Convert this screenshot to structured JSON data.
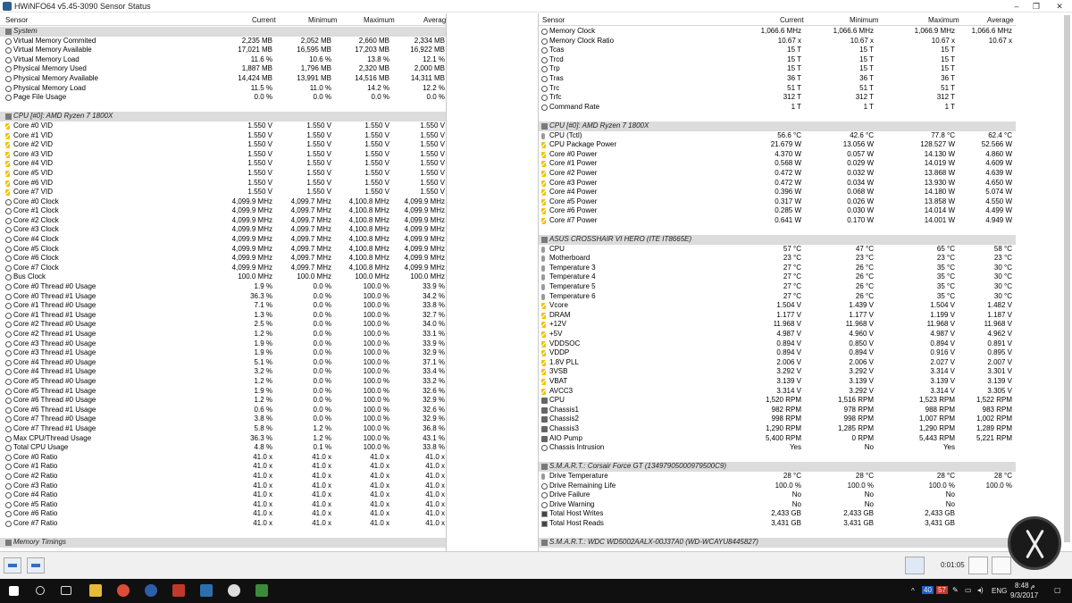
{
  "window": {
    "title": "HWiNFO64 v5.45-3090 Sensor Status"
  },
  "columns": {
    "sensor": "Sensor",
    "current": "Current",
    "minimum": "Minimum",
    "maximum": "Maximum",
    "average": "Average"
  },
  "left_rows": [
    {
      "g": 1,
      "name": "System"
    },
    {
      "i": "gauge",
      "name": "Virtual Memory Commited",
      "cur": "2,235 MB",
      "min": "2,052 MB",
      "max": "2,660 MB",
      "avg": "2,334 MB"
    },
    {
      "i": "gauge",
      "name": "Virtual Memory Available",
      "cur": "17,021 MB",
      "min": "16,595 MB",
      "max": "17,203 MB",
      "avg": "16,922 MB"
    },
    {
      "i": "gauge",
      "name": "Virtual Memory Load",
      "cur": "11.6 %",
      "min": "10.6 %",
      "max": "13.8 %",
      "avg": "12.1 %"
    },
    {
      "i": "gauge",
      "name": "Physical Memory Used",
      "cur": "1,887 MB",
      "min": "1,796 MB",
      "max": "2,320 MB",
      "avg": "2,000 MB"
    },
    {
      "i": "gauge",
      "name": "Physical Memory Available",
      "cur": "14,424 MB",
      "min": "13,991 MB",
      "max": "14,516 MB",
      "avg": "14,311 MB"
    },
    {
      "i": "gauge",
      "name": "Physical Memory Load",
      "cur": "11.5 %",
      "min": "11.0 %",
      "max": "14.2 %",
      "avg": "12.2 %"
    },
    {
      "i": "gauge",
      "name": "Page File Usage",
      "cur": "0.0 %",
      "min": "0.0 %",
      "max": "0.0 %",
      "avg": "0.0 %"
    },
    {
      "blank": 1
    },
    {
      "g": 1,
      "name": "CPU [#0]: AMD Ryzen 7 1800X"
    },
    {
      "i": "bolt",
      "name": "Core #0 VID",
      "cur": "1.550 V",
      "min": "1.550 V",
      "max": "1.550 V",
      "avg": "1.550 V"
    },
    {
      "i": "bolt",
      "name": "Core #1 VID",
      "cur": "1.550 V",
      "min": "1.550 V",
      "max": "1.550 V",
      "avg": "1.550 V"
    },
    {
      "i": "bolt",
      "name": "Core #2 VID",
      "cur": "1.550 V",
      "min": "1.550 V",
      "max": "1.550 V",
      "avg": "1.550 V"
    },
    {
      "i": "bolt",
      "name": "Core #3 VID",
      "cur": "1.550 V",
      "min": "1.550 V",
      "max": "1.550 V",
      "avg": "1.550 V"
    },
    {
      "i": "bolt",
      "name": "Core #4 VID",
      "cur": "1.550 V",
      "min": "1.550 V",
      "max": "1.550 V",
      "avg": "1.550 V"
    },
    {
      "i": "bolt",
      "name": "Core #5 VID",
      "cur": "1.550 V",
      "min": "1.550 V",
      "max": "1.550 V",
      "avg": "1.550 V"
    },
    {
      "i": "bolt",
      "name": "Core #6 VID",
      "cur": "1.550 V",
      "min": "1.550 V",
      "max": "1.550 V",
      "avg": "1.550 V"
    },
    {
      "i": "bolt",
      "name": "Core #7 VID",
      "cur": "1.550 V",
      "min": "1.550 V",
      "max": "1.550 V",
      "avg": "1.550 V"
    },
    {
      "i": "clock",
      "name": "Core #0 Clock",
      "cur": "4,099.9 MHz",
      "min": "4,099.7 MHz",
      "max": "4,100.8 MHz",
      "avg": "4,099.9 MHz"
    },
    {
      "i": "clock",
      "name": "Core #1 Clock",
      "cur": "4,099.9 MHz",
      "min": "4,099.7 MHz",
      "max": "4,100.8 MHz",
      "avg": "4,099.9 MHz"
    },
    {
      "i": "clock",
      "name": "Core #2 Clock",
      "cur": "4,099.9 MHz",
      "min": "4,099.7 MHz",
      "max": "4,100.8 MHz",
      "avg": "4,099.9 MHz"
    },
    {
      "i": "clock",
      "name": "Core #3 Clock",
      "cur": "4,099.9 MHz",
      "min": "4,099.7 MHz",
      "max": "4,100.8 MHz",
      "avg": "4,099.9 MHz"
    },
    {
      "i": "clock",
      "name": "Core #4 Clock",
      "cur": "4,099.9 MHz",
      "min": "4,099.7 MHz",
      "max": "4,100.8 MHz",
      "avg": "4,099.9 MHz"
    },
    {
      "i": "clock",
      "name": "Core #5 Clock",
      "cur": "4,099.9 MHz",
      "min": "4,099.7 MHz",
      "max": "4,100.8 MHz",
      "avg": "4,099.9 MHz"
    },
    {
      "i": "clock",
      "name": "Core #6 Clock",
      "cur": "4,099.9 MHz",
      "min": "4,099.7 MHz",
      "max": "4,100.8 MHz",
      "avg": "4,099.9 MHz"
    },
    {
      "i": "clock",
      "name": "Core #7 Clock",
      "cur": "4,099.9 MHz",
      "min": "4,099.7 MHz",
      "max": "4,100.8 MHz",
      "avg": "4,099.9 MHz"
    },
    {
      "i": "clock",
      "name": "Bus Clock",
      "cur": "100.0 MHz",
      "min": "100.0 MHz",
      "max": "100.0 MHz",
      "avg": "100.0 MHz"
    },
    {
      "i": "gauge",
      "name": "Core #0 Thread #0 Usage",
      "cur": "1.9 %",
      "min": "0.0 %",
      "max": "100.0 %",
      "avg": "33.9 %"
    },
    {
      "i": "gauge",
      "name": "Core #0 Thread #1 Usage",
      "cur": "36.3 %",
      "min": "0.0 %",
      "max": "100.0 %",
      "avg": "34.2 %"
    },
    {
      "i": "gauge",
      "name": "Core #1 Thread #0 Usage",
      "cur": "7.1 %",
      "min": "0.0 %",
      "max": "100.0 %",
      "avg": "33.8 %"
    },
    {
      "i": "gauge",
      "name": "Core #1 Thread #1 Usage",
      "cur": "1.3 %",
      "min": "0.0 %",
      "max": "100.0 %",
      "avg": "32.7 %"
    },
    {
      "i": "gauge",
      "name": "Core #2 Thread #0 Usage",
      "cur": "2.5 %",
      "min": "0.0 %",
      "max": "100.0 %",
      "avg": "34.0 %"
    },
    {
      "i": "gauge",
      "name": "Core #2 Thread #1 Usage",
      "cur": "1.2 %",
      "min": "0.0 %",
      "max": "100.0 %",
      "avg": "33.1 %"
    },
    {
      "i": "gauge",
      "name": "Core #3 Thread #0 Usage",
      "cur": "1.9 %",
      "min": "0.0 %",
      "max": "100.0 %",
      "avg": "33.9 %"
    },
    {
      "i": "gauge",
      "name": "Core #3 Thread #1 Usage",
      "cur": "1.9 %",
      "min": "0.0 %",
      "max": "100.0 %",
      "avg": "32.9 %"
    },
    {
      "i": "gauge",
      "name": "Core #4 Thread #0 Usage",
      "cur": "5.1 %",
      "min": "0.0 %",
      "max": "100.0 %",
      "avg": "37.1 %"
    },
    {
      "i": "gauge",
      "name": "Core #4 Thread #1 Usage",
      "cur": "3.2 %",
      "min": "0.0 %",
      "max": "100.0 %",
      "avg": "33.4 %"
    },
    {
      "i": "gauge",
      "name": "Core #5 Thread #0 Usage",
      "cur": "1.2 %",
      "min": "0.0 %",
      "max": "100.0 %",
      "avg": "33.2 %"
    },
    {
      "i": "gauge",
      "name": "Core #5 Thread #1 Usage",
      "cur": "1.9 %",
      "min": "0.0 %",
      "max": "100.0 %",
      "avg": "32.6 %"
    },
    {
      "i": "gauge",
      "name": "Core #6 Thread #0 Usage",
      "cur": "1.2 %",
      "min": "0.0 %",
      "max": "100.0 %",
      "avg": "32.9 %"
    },
    {
      "i": "gauge",
      "name": "Core #6 Thread #1 Usage",
      "cur": "0.6 %",
      "min": "0.0 %",
      "max": "100.0 %",
      "avg": "32.6 %"
    },
    {
      "i": "gauge",
      "name": "Core #7 Thread #0 Usage",
      "cur": "3.8 %",
      "min": "0.0 %",
      "max": "100.0 %",
      "avg": "32.9 %"
    },
    {
      "i": "gauge",
      "name": "Core #7 Thread #1 Usage",
      "cur": "5.8 %",
      "min": "1.2 %",
      "max": "100.0 %",
      "avg": "36.8 %"
    },
    {
      "i": "gauge",
      "name": "Max CPU/Thread Usage",
      "cur": "36.3 %",
      "min": "1.2 %",
      "max": "100.0 %",
      "avg": "43.1 %"
    },
    {
      "i": "gauge",
      "name": "Total CPU Usage",
      "cur": "4.8 %",
      "min": "0.1 %",
      "max": "100.0 %",
      "avg": "33.8 %"
    },
    {
      "i": "gauge",
      "name": "Core #0 Ratio",
      "cur": "41.0 x",
      "min": "41.0 x",
      "max": "41.0 x",
      "avg": "41.0 x"
    },
    {
      "i": "gauge",
      "name": "Core #1 Ratio",
      "cur": "41.0 x",
      "min": "41.0 x",
      "max": "41.0 x",
      "avg": "41.0 x"
    },
    {
      "i": "gauge",
      "name": "Core #2 Ratio",
      "cur": "41.0 x",
      "min": "41.0 x",
      "max": "41.0 x",
      "avg": "41.0 x"
    },
    {
      "i": "gauge",
      "name": "Core #3 Ratio",
      "cur": "41.0 x",
      "min": "41.0 x",
      "max": "41.0 x",
      "avg": "41.0 x"
    },
    {
      "i": "gauge",
      "name": "Core #4 Ratio",
      "cur": "41.0 x",
      "min": "41.0 x",
      "max": "41.0 x",
      "avg": "41.0 x"
    },
    {
      "i": "gauge",
      "name": "Core #5 Ratio",
      "cur": "41.0 x",
      "min": "41.0 x",
      "max": "41.0 x",
      "avg": "41.0 x"
    },
    {
      "i": "gauge",
      "name": "Core #6 Ratio",
      "cur": "41.0 x",
      "min": "41.0 x",
      "max": "41.0 x",
      "avg": "41.0 x"
    },
    {
      "i": "gauge",
      "name": "Core #7 Ratio",
      "cur": "41.0 x",
      "min": "41.0 x",
      "max": "41.0 x",
      "avg": "41.0 x"
    },
    {
      "blank": 1
    },
    {
      "g": 1,
      "name": "Memory Timings"
    }
  ],
  "right_rows": [
    {
      "i": "gauge",
      "name": "Memory Clock",
      "cur": "1,066.6 MHz",
      "min": "1,066.6 MHz",
      "max": "1,066.9 MHz",
      "avg": "1,066.6 MHz"
    },
    {
      "i": "gauge",
      "name": "Memory Clock Ratio",
      "cur": "10.67 x",
      "min": "10.67 x",
      "max": "10.67 x",
      "avg": "10.67 x"
    },
    {
      "i": "gauge",
      "name": "Tcas",
      "cur": "15 T",
      "min": "15 T",
      "max": "15 T",
      "avg": ""
    },
    {
      "i": "gauge",
      "name": "Trcd",
      "cur": "15 T",
      "min": "15 T",
      "max": "15 T",
      "avg": ""
    },
    {
      "i": "gauge",
      "name": "Trp",
      "cur": "15 T",
      "min": "15 T",
      "max": "15 T",
      "avg": ""
    },
    {
      "i": "gauge",
      "name": "Tras",
      "cur": "36 T",
      "min": "36 T",
      "max": "36 T",
      "avg": ""
    },
    {
      "i": "gauge",
      "name": "Trc",
      "cur": "51 T",
      "min": "51 T",
      "max": "51 T",
      "avg": ""
    },
    {
      "i": "gauge",
      "name": "Trfc",
      "cur": "312 T",
      "min": "312 T",
      "max": "312 T",
      "avg": ""
    },
    {
      "i": "gauge",
      "name": "Command Rate",
      "cur": "1 T",
      "min": "1 T",
      "max": "1 T",
      "avg": ""
    },
    {
      "blank": 1
    },
    {
      "g": 1,
      "name": "CPU [#0]: AMD Ryzen 7 1800X"
    },
    {
      "i": "therm",
      "name": "CPU (Tctl)",
      "cur": "56.6 °C",
      "min": "42.6 °C",
      "max": "77.8 °C",
      "avg": "62.4 °C"
    },
    {
      "i": "bolt",
      "name": "CPU Package Power",
      "cur": "21.679 W",
      "min": "13.056 W",
      "max": "128.527 W",
      "avg": "52.566 W"
    },
    {
      "i": "bolt",
      "name": "Core #0 Power",
      "cur": "4.370 W",
      "min": "0.057 W",
      "max": "14.130 W",
      "avg": "4.860 W"
    },
    {
      "i": "bolt",
      "name": "Core #1 Power",
      "cur": "0.568 W",
      "min": "0.029 W",
      "max": "14.019 W",
      "avg": "4.609 W"
    },
    {
      "i": "bolt",
      "name": "Core #2 Power",
      "cur": "0.472 W",
      "min": "0.032 W",
      "max": "13.868 W",
      "avg": "4.639 W"
    },
    {
      "i": "bolt",
      "name": "Core #3 Power",
      "cur": "0.472 W",
      "min": "0.034 W",
      "max": "13.930 W",
      "avg": "4.650 W"
    },
    {
      "i": "bolt",
      "name": "Core #4 Power",
      "cur": "0.396 W",
      "min": "0.068 W",
      "max": "14.180 W",
      "avg": "5.074 W"
    },
    {
      "i": "bolt",
      "name": "Core #5 Power",
      "cur": "0.317 W",
      "min": "0.026 W",
      "max": "13.858 W",
      "avg": "4.550 W"
    },
    {
      "i": "bolt",
      "name": "Core #6 Power",
      "cur": "0.285 W",
      "min": "0.030 W",
      "max": "14.014 W",
      "avg": "4.499 W"
    },
    {
      "i": "bolt",
      "name": "Core #7 Power",
      "cur": "0.641 W",
      "min": "0.170 W",
      "max": "14.001 W",
      "avg": "4.949 W"
    },
    {
      "blank": 1
    },
    {
      "g": 1,
      "name": "ASUS CROSSHAIR VI HERO (ITE IT8665E)"
    },
    {
      "i": "therm",
      "name": "CPU",
      "cur": "57 °C",
      "min": "47 °C",
      "max": "65 °C",
      "avg": "58 °C"
    },
    {
      "i": "therm",
      "name": "Motherboard",
      "cur": "23 °C",
      "min": "23 °C",
      "max": "23 °C",
      "avg": "23 °C"
    },
    {
      "i": "therm",
      "name": "Temperature 3",
      "cur": "27 °C",
      "min": "26 °C",
      "max": "35 °C",
      "avg": "30 °C"
    },
    {
      "i": "therm",
      "name": "Temperature 4",
      "cur": "27 °C",
      "min": "26 °C",
      "max": "35 °C",
      "avg": "30 °C"
    },
    {
      "i": "therm",
      "name": "Temperature 5",
      "cur": "27 °C",
      "min": "26 °C",
      "max": "35 °C",
      "avg": "30 °C"
    },
    {
      "i": "therm",
      "name": "Temperature 6",
      "cur": "27 °C",
      "min": "26 °C",
      "max": "35 °C",
      "avg": "30 °C"
    },
    {
      "i": "bolt",
      "name": "Vcore",
      "cur": "1.504 V",
      "min": "1.439 V",
      "max": "1.504 V",
      "avg": "1.482 V"
    },
    {
      "i": "bolt",
      "name": "DRAM",
      "cur": "1.177 V",
      "min": "1.177 V",
      "max": "1.199 V",
      "avg": "1.187 V"
    },
    {
      "i": "bolt",
      "name": "+12V",
      "cur": "11.968 V",
      "min": "11.968 V",
      "max": "11.968 V",
      "avg": "11.968 V"
    },
    {
      "i": "bolt",
      "name": "+5V",
      "cur": "4.987 V",
      "min": "4.960 V",
      "max": "4.987 V",
      "avg": "4.962 V"
    },
    {
      "i": "bolt",
      "name": "VDDSOC",
      "cur": "0.894 V",
      "min": "0.850 V",
      "max": "0.894 V",
      "avg": "0.891 V"
    },
    {
      "i": "bolt",
      "name": "VDDP",
      "cur": "0.894 V",
      "min": "0.894 V",
      "max": "0.916 V",
      "avg": "0.895 V"
    },
    {
      "i": "bolt",
      "name": "1.8V PLL",
      "cur": "2.006 V",
      "min": "2.006 V",
      "max": "2.027 V",
      "avg": "2.007 V"
    },
    {
      "i": "bolt",
      "name": "3VSB",
      "cur": "3.292 V",
      "min": "3.292 V",
      "max": "3.314 V",
      "avg": "3.301 V"
    },
    {
      "i": "bolt",
      "name": "VBAT",
      "cur": "3.139 V",
      "min": "3.139 V",
      "max": "3.139 V",
      "avg": "3.139 V"
    },
    {
      "i": "bolt",
      "name": "AVCC3",
      "cur": "3.314 V",
      "min": "3.292 V",
      "max": "3.314 V",
      "avg": "3.305 V"
    },
    {
      "i": "fan",
      "name": "CPU",
      "cur": "1,520 RPM",
      "min": "1,516 RPM",
      "max": "1,523 RPM",
      "avg": "1,522 RPM"
    },
    {
      "i": "fan",
      "name": "Chassis1",
      "cur": "982 RPM",
      "min": "978 RPM",
      "max": "988 RPM",
      "avg": "983 RPM"
    },
    {
      "i": "fan",
      "name": "Chassis2",
      "cur": "998 RPM",
      "min": "998 RPM",
      "max": "1,007 RPM",
      "avg": "1,002 RPM"
    },
    {
      "i": "fan",
      "name": "Chassis3",
      "cur": "1,290 RPM",
      "min": "1,285 RPM",
      "max": "1,290 RPM",
      "avg": "1,289 RPM"
    },
    {
      "i": "fan",
      "name": "AIO Pump",
      "cur": "5,400 RPM",
      "min": "0 RPM",
      "max": "5,443 RPM",
      "avg": "5,221 RPM"
    },
    {
      "i": "gauge",
      "name": "Chassis Intrusion",
      "cur": "Yes",
      "min": "No",
      "max": "Yes",
      "avg": ""
    },
    {
      "blank": 1
    },
    {
      "g": 1,
      "name": "S.M.A.R.T.: Corsair Force GT (13497905000979500C9)"
    },
    {
      "i": "therm",
      "name": "Drive Temperature",
      "cur": "28 °C",
      "min": "28 °C",
      "max": "28 °C",
      "avg": "28 °C"
    },
    {
      "i": "gauge",
      "name": "Drive Remaining Life",
      "cur": "100.0 %",
      "min": "100.0 %",
      "max": "100.0 %",
      "avg": "100.0 %"
    },
    {
      "i": "gauge",
      "name": "Drive Failure",
      "cur": "No",
      "min": "No",
      "max": "No",
      "avg": ""
    },
    {
      "i": "gauge",
      "name": "Drive Warning",
      "cur": "No",
      "min": "No",
      "max": "No",
      "avg": ""
    },
    {
      "i": "chip",
      "name": "Total Host Writes",
      "cur": "2,433 GB",
      "min": "2,433 GB",
      "max": "2,433 GB",
      "avg": ""
    },
    {
      "i": "chip",
      "name": "Total Host Reads",
      "cur": "3,431 GB",
      "min": "3,431 GB",
      "max": "3,431 GB",
      "avg": ""
    },
    {
      "blank": 1
    },
    {
      "g": 1,
      "name": "S.M.A.R.T.: WDC WD5002AALX-00J37A0 (WD-WCAYU8445827)"
    }
  ],
  "bottombar": {
    "elapsed": "0:01:05"
  },
  "taskbar": {
    "lang": "ENG",
    "time": "8:48 م",
    "date": "9/3/2017",
    "badge1": "40",
    "badge2": "57"
  },
  "colors": {
    "group_row": "#dcdcdc",
    "taskbar": "#101010"
  }
}
